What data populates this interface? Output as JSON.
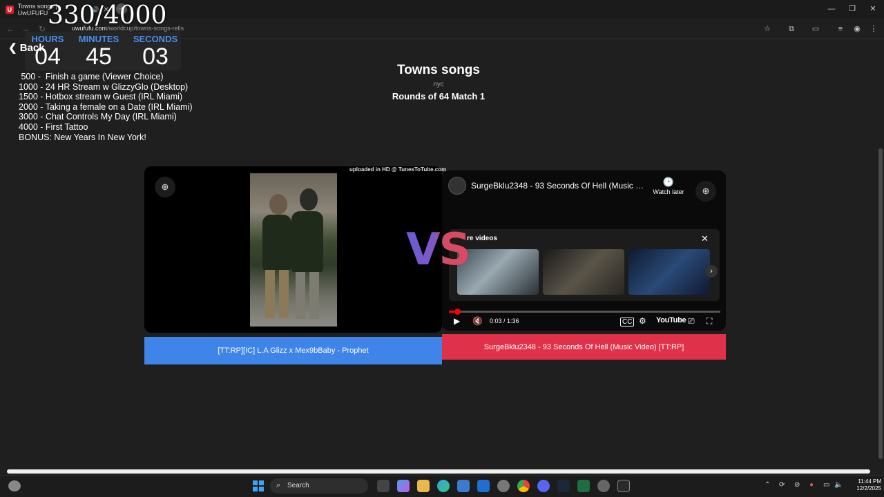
{
  "browser": {
    "tab_title": "Towns songs | UwUFUFU",
    "tab_favicon": "U",
    "url_domain": "uwufufu.com",
    "url_path": "/worldcup/towns-songs-rells"
  },
  "overlay": {
    "counter": "330/4000",
    "timer": {
      "hours_label": "HOURS",
      "hours": "04",
      "minutes_label": "MINUTES",
      "minutes": "45",
      "seconds_label": "SECONDS",
      "seconds": "03"
    },
    "goals": [
      " 500 -  Finish a game (Viewer Choice)",
      "1000 - 24 HR Stream w GlizzyGlo (Desktop)",
      "1500 - Hotbox stream w Guest (IRL Miami)",
      "2000 - Taking a female on a Date (IRL Miami)",
      "3000 - Chat Controls My Day (IRL Miami)",
      "4000 - First Tattoo",
      "BONUS: New Years In New York!"
    ]
  },
  "page": {
    "back_label": "Back",
    "title": "Towns songs",
    "subtitle": "nyc",
    "round": "Rounds of 64 Match 1",
    "vs": "VS"
  },
  "left": {
    "watermark": "uploaded in HD @ TunesToTube.com",
    "choice_label": "[TT:RP][IC] L.A Glizz x Mex9bBaby - Prophet"
  },
  "right": {
    "video_title": "SurgeBklu2348 - 93 Seconds Of Hell (Music Vi...",
    "watch_later": "Watch later",
    "more_videos": "re videos",
    "time": "0:03 / 1:36",
    "progress": 0.03,
    "youtube_logo": "YouTube",
    "choice_label": "SurgeBklu2348 - 93 Seconds Of Hell (Music Video) [TT:RP]"
  },
  "taskbar": {
    "search_placeholder": "Search",
    "time": "11:44 PM",
    "date": "12/2/2025"
  }
}
